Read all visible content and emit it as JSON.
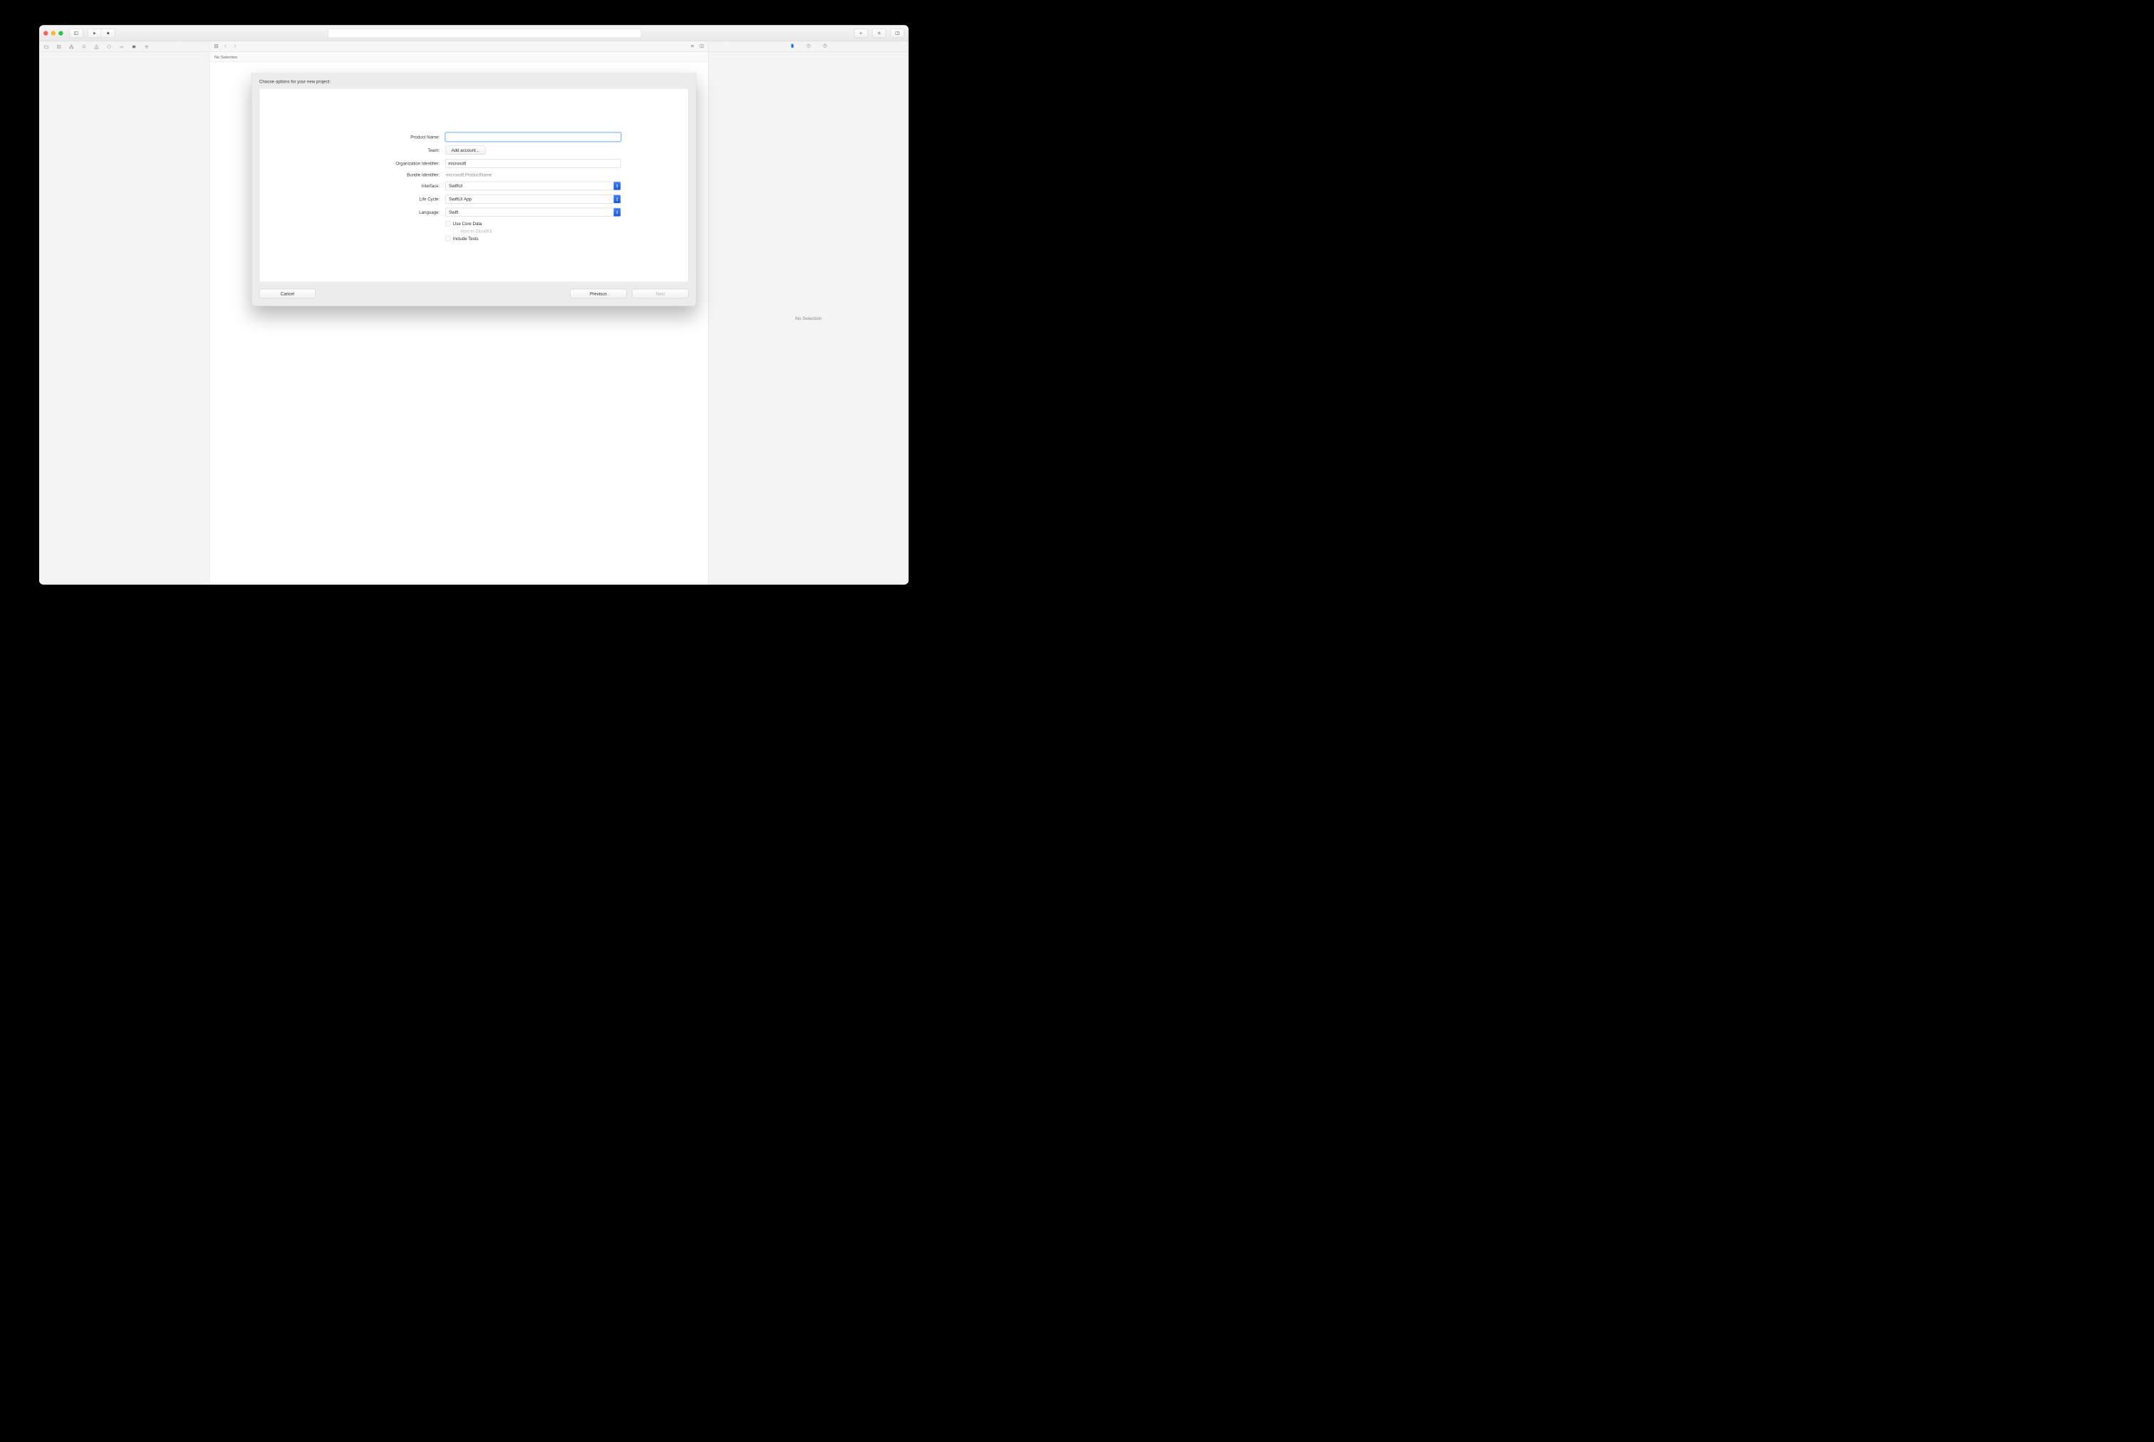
{
  "sheet": {
    "title": "Choose options for your new project:",
    "labels": {
      "product_name": "Product Name:",
      "team": "Team:",
      "org_identifier": "Organization Identifier:",
      "bundle_identifier": "Bundle Identifier:",
      "interface": "Interface:",
      "life_cycle": "Life Cycle:",
      "language": "Language:"
    },
    "values": {
      "product_name": "",
      "team_button": "Add account...",
      "org_identifier": "microsoft",
      "bundle_identifier": "microsoft.ProductName",
      "interface": "SwiftUI",
      "life_cycle": "SwiftUI App",
      "language": "Swift"
    },
    "checkboxes": {
      "use_core_data": "Use Core Data",
      "host_in_cloudkit": "Host in CloudKit",
      "include_tests": "Include Tests"
    },
    "buttons": {
      "cancel": "Cancel",
      "previous": "Previous",
      "next": "Next"
    }
  },
  "editor": {
    "no_selection_breadcrumb": "No Selection"
  },
  "inspector": {
    "no_selection": "No Selection"
  }
}
